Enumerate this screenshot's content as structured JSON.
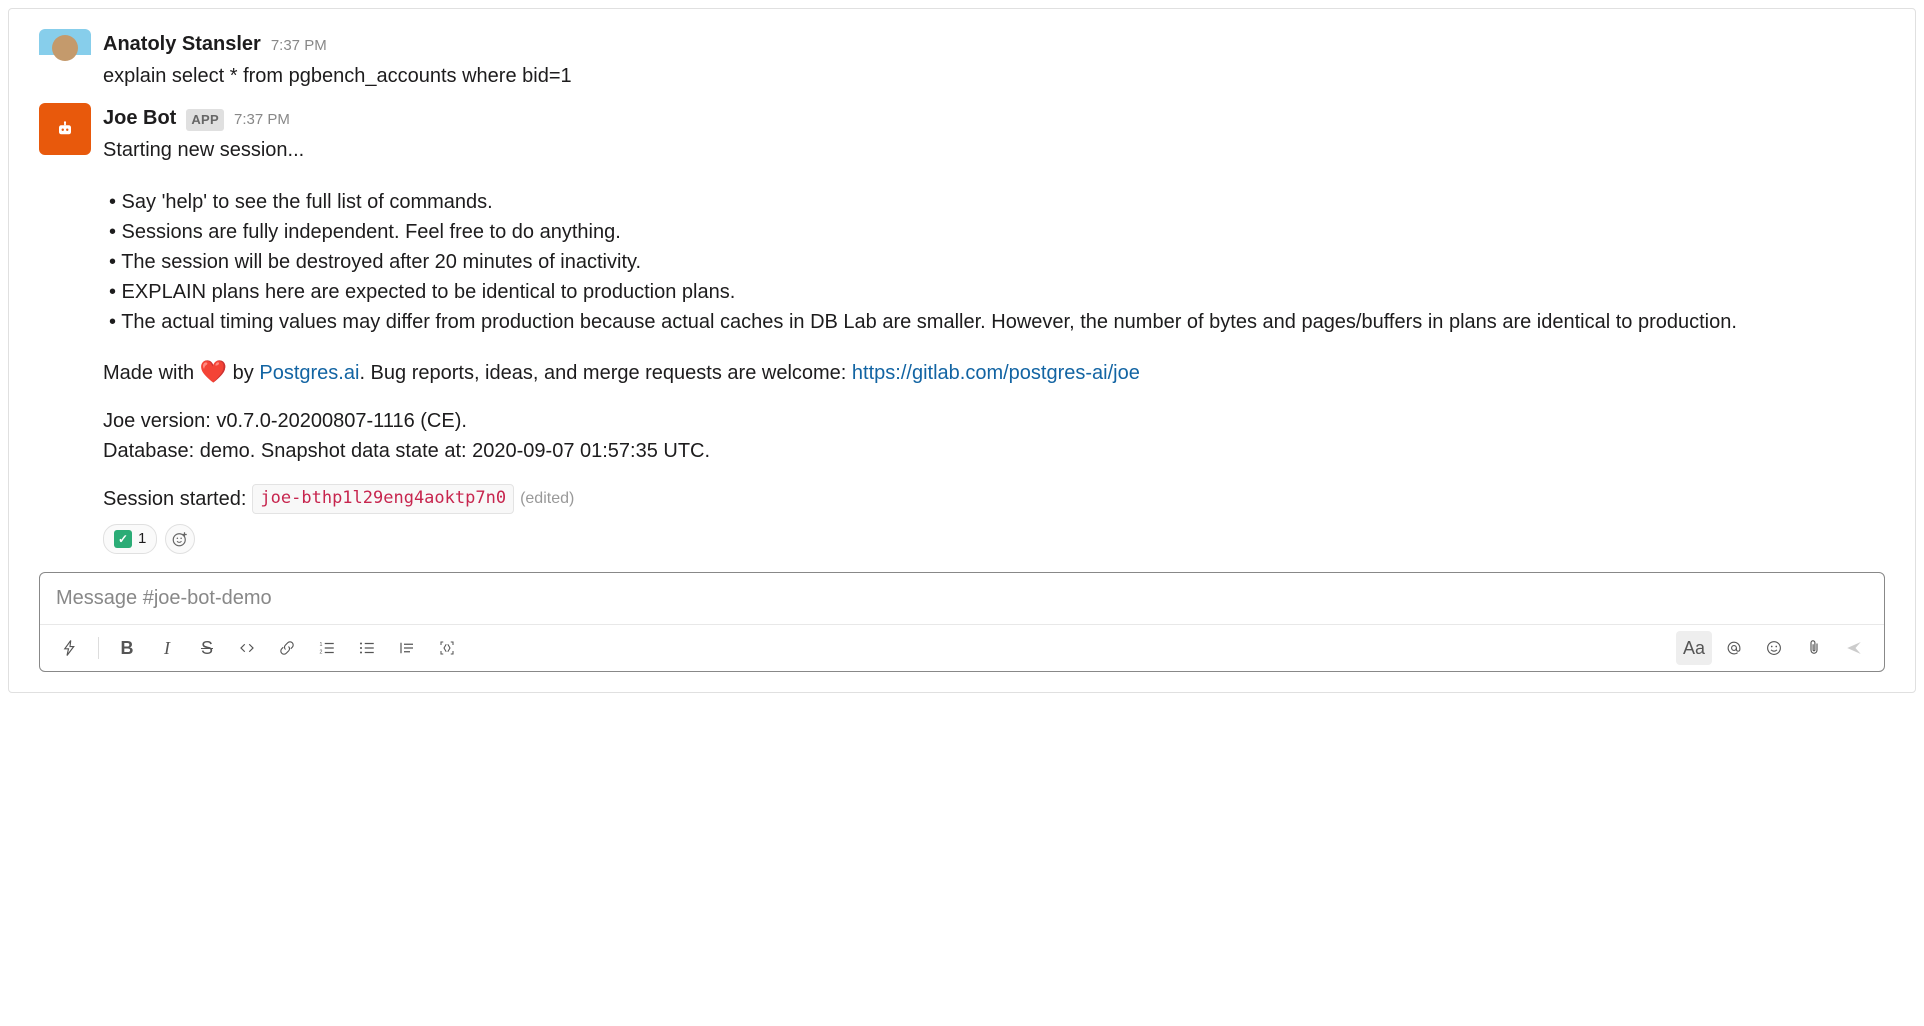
{
  "messages": {
    "user": {
      "name": "Anatoly Stansler",
      "time": "7:37 PM",
      "text": "explain select * from pgbench_accounts where bid=1"
    },
    "bot": {
      "name": "Joe Bot",
      "badge": "APP",
      "time": "7:37 PM",
      "intro": "Starting new session...",
      "bullets": [
        "• Say 'help' to see the full list of commands.",
        "• Sessions are fully independent. Feel free to do anything.",
        "• The session will be destroyed after 20 minutes of inactivity.",
        "• EXPLAIN plans here are expected to be identical to production plans.",
        "• The actual timing values may differ from production because actual caches in DB Lab are smaller. However, the number of bytes and pages/buffers in plans are identical to production."
      ],
      "made_with_prefix": "Made with ",
      "made_with_by": " by ",
      "postgres_link": "Postgres.ai",
      "made_with_mid": ". Bug reports, ideas, and merge requests are welcome: ",
      "repo_link": "https://gitlab.com/postgres-ai/joe",
      "version_line": "Joe version: v0.7.0-20200807-1116 (CE).",
      "database_line": "Database: demo. Snapshot data state at: 2020-09-07 01:57:35 UTC.",
      "session_label": "Session started: ",
      "session_id": "joe-bthp1l29eng4aoktp7n0",
      "edited": "(edited)",
      "reaction_count": "1"
    }
  },
  "composer": {
    "placeholder": "Message #joe-bot-demo",
    "tools": {
      "bold": "B",
      "italic": "I",
      "strike": "S",
      "aa": "Aa"
    }
  }
}
